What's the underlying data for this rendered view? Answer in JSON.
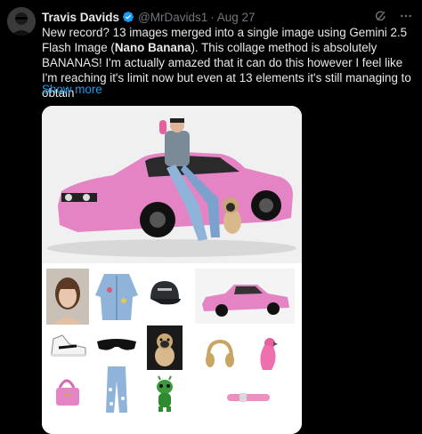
{
  "tweet": {
    "author_name": "Travis Davids",
    "handle": "@MrDavids1",
    "separator": "·",
    "date": "Aug 27",
    "text_part1": "New record? 13 images merged into a single image using Gemini 2.5 Flash Image (",
    "text_bold": "Nano Banana",
    "text_part2": "). This collage method is absolutely BANANAS! I'm actually amazed that it can do this however I feel like I'm reaching it's limit now but even at 13 elements it's still managing to obtain",
    "show_more": "Show more"
  },
  "icons": {
    "verified": "verified-badge-icon",
    "grok": "grok-icon",
    "more": "more-options-icon"
  },
  "colors": {
    "background": "#000000",
    "text": "#e7e9ea",
    "muted": "#71767b",
    "link": "#1d9bf0",
    "car_pink": "#e584c4"
  },
  "media": {
    "hero": "pink BMW car with model and pug",
    "thumbnails": [
      "woman portrait",
      "denim jacket",
      "black cap",
      "pink car",
      "white sneaker",
      "black sunglasses",
      "pug dog",
      "gold headphones",
      "pink parrot",
      "pink handbag",
      "floral jeans",
      "green alien toy",
      "pink dog collar"
    ]
  }
}
